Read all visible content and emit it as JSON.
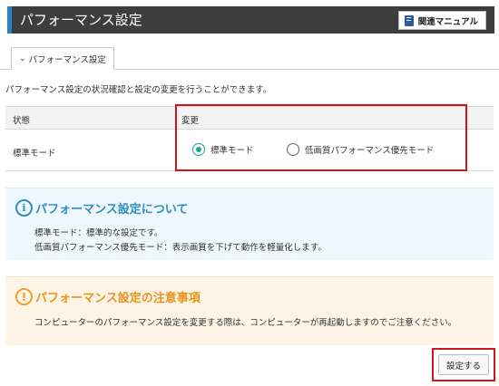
{
  "header": {
    "title": "パフォーマンス設定",
    "manual_label": "関連マニュアル",
    "accent": "#2b7fc9"
  },
  "tab": {
    "label": "パフォーマンス設定"
  },
  "intro": "パフォーマンス設定の状況確認と設定の変更を行うことができます。",
  "table": {
    "col_status": "状態",
    "col_change": "変更",
    "current_value": "標準モード",
    "options": [
      {
        "label": "標準モード",
        "selected": true
      },
      {
        "label": "低画質パフォーマンス優先モード",
        "selected": false
      }
    ]
  },
  "info": {
    "title": "パフォーマンス設定について",
    "lines": [
      "標準モード：標準的な設定です。",
      "低画質パフォーマンス優先モード：表示画質を下げて動作を軽量化します。"
    ],
    "color": "#2c8fc1"
  },
  "warning": {
    "title": "パフォーマンス設定の注意事項",
    "lines": [
      "コンピューターのパフォーマンス設定を変更する際は、コンピューターが再起動しますのでご注意ください。"
    ],
    "color": "#f0a02b"
  },
  "submit_label": "設定する",
  "highlight_color": "#d4141b"
}
